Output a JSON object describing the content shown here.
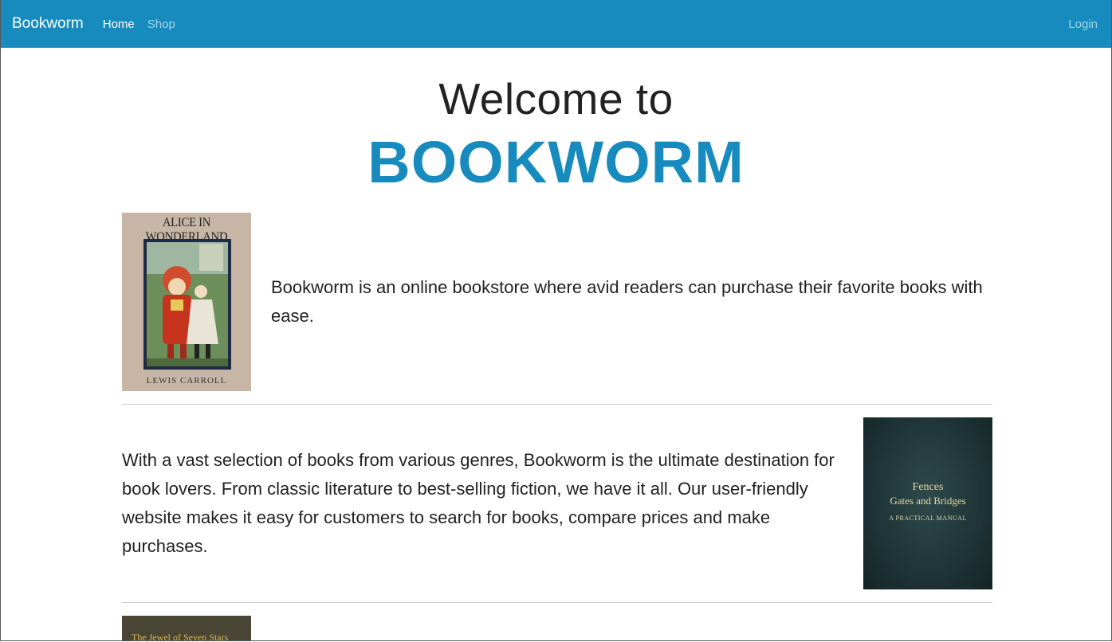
{
  "navbar": {
    "brand": "Bookworm",
    "links": [
      {
        "label": "Home",
        "active": true
      },
      {
        "label": "Shop",
        "active": false
      }
    ],
    "login_label": "Login",
    "background": "#178bbd"
  },
  "hero": {
    "line1": "Welcome to",
    "line2": "BOOKWORM",
    "accent_color": "#178bbd"
  },
  "sections": [
    {
      "text": "Bookworm is an online bookstore where avid readers can purchase their favorite books with ease.",
      "cover": {
        "title": "ALICE IN WONDERLAND",
        "author": "LEWIS CARROLL"
      }
    },
    {
      "text": "With a vast selection of books from various genres, Bookworm is the ultimate destination for book lovers. From classic literature to best-selling fiction, we have it all. Our user-friendly website makes it easy for customers to search for books, compare prices and make purchases.",
      "cover": {
        "line1": "Fences",
        "line2": "Gates and Bridges",
        "subtitle": "A PRACTICAL MANUAL"
      }
    },
    {
      "text": "",
      "cover": {
        "title": "The Jewel of Seven Stars"
      }
    }
  ]
}
